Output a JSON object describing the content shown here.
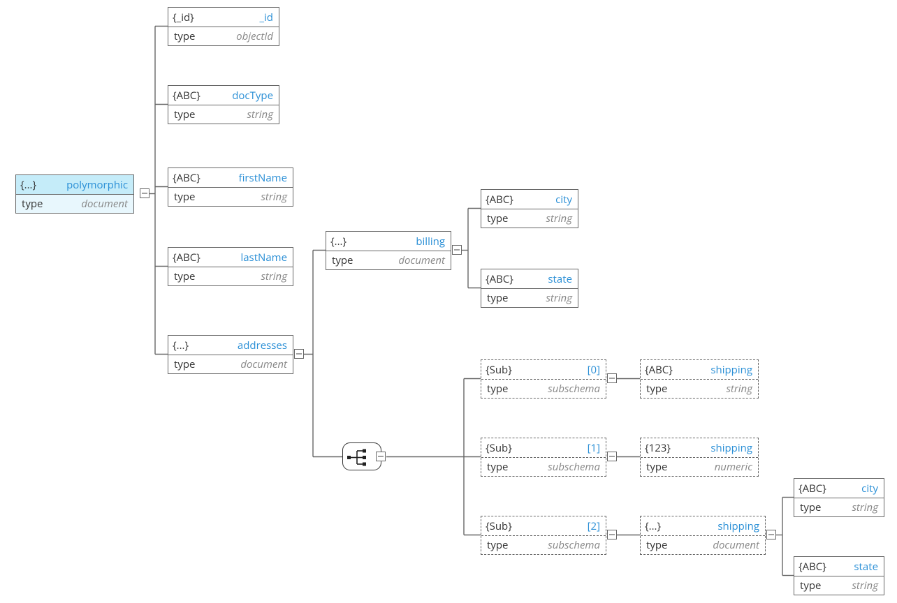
{
  "labels": {
    "typeKey": "type"
  },
  "nodes": {
    "poly": {
      "tag": "{...}",
      "name": "polymorphic",
      "type": "document"
    },
    "id": {
      "tag": "{_id}",
      "name": "_id",
      "type": "objectId"
    },
    "docType": {
      "tag": "{ABC}",
      "name": "docType",
      "type": "string"
    },
    "firstName": {
      "tag": "{ABC}",
      "name": "firstName",
      "type": "string"
    },
    "lastName": {
      "tag": "{ABC}",
      "name": "lastName",
      "type": "string"
    },
    "addresses": {
      "tag": "{...}",
      "name": "addresses",
      "type": "document"
    },
    "billing": {
      "tag": "{...}",
      "name": "billing",
      "type": "document"
    },
    "city": {
      "tag": "{ABC}",
      "name": "city",
      "type": "string"
    },
    "state": {
      "tag": "{ABC}",
      "name": "state",
      "type": "string"
    },
    "sub0": {
      "tag": "{Sub}",
      "name": "[0]",
      "type": "subschema"
    },
    "sub1": {
      "tag": "{Sub}",
      "name": "[1]",
      "type": "subschema"
    },
    "sub2": {
      "tag": "{Sub}",
      "name": "[2]",
      "type": "subschema"
    },
    "ship0": {
      "tag": "{ABC}",
      "name": "shipping",
      "type": "string"
    },
    "ship1": {
      "tag": "{123}",
      "name": "shipping",
      "type": "numeric"
    },
    "ship2": {
      "tag": "{...}",
      "name": "shipping",
      "type": "document"
    },
    "city2": {
      "tag": "{ABC}",
      "name": "city",
      "type": "string"
    },
    "state2": {
      "tag": "{ABC}",
      "name": "state",
      "type": "string"
    }
  }
}
